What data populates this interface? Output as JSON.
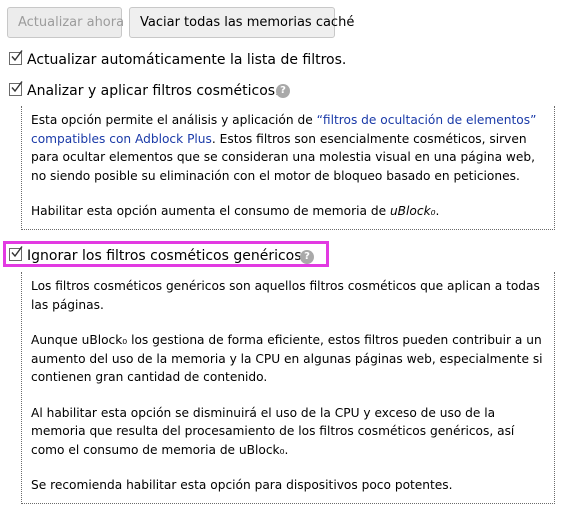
{
  "toolbar": {
    "update_now_label": "Actualizar ahora",
    "purge_caches_label": "Vaciar todas las memorias caché"
  },
  "options": {
    "auto_update": {
      "label": "Actualizar automáticamente la lista de filtros.",
      "checked": true
    },
    "cosmetic": {
      "label": "Analizar y aplicar filtros cosméticos.",
      "checked": true,
      "help": "?",
      "desc_p1_a": "Esta opción permite el análisis y aplicación de ",
      "desc_p1_link": "“filtros de ocultación de elementos” compatibles con Adblock Plus",
      "desc_p1_b": ". Estos filtros son esencialmente cosméticos, sirven para ocultar elementos que se consideran una molestia visual en una página web, no siendo posible su eliminación con el motor de bloqueo basado en peticiones.",
      "desc_p2_a": "Habilitar esta opción aumenta el consumo de memoria de ",
      "desc_p2_brand": "uBlock₀",
      "desc_p2_b": "."
    },
    "generic_cosmetic": {
      "label": "Ignorar los filtros cosméticos genéricos",
      "checked": true,
      "help": "?",
      "desc_p1": "Los filtros cosméticos genéricos son aquellos filtros cosméticos que aplican a todas las páginas.",
      "desc_p2": "Aunque uBlock₀ los gestiona de forma eficiente, estos filtros pueden contribuir a un aumento del uso de la memoria y la CPU en algunas páginas web, especialmente si contienen gran cantidad de contenido.",
      "desc_p3": "Al habilitar esta opción se disminuirá el uso de la CPU y exceso de uso de la memoria que resulta del procesamiento de los filtros cosméticos genéricos, así como el consumo de memoria de uBlock₀.",
      "desc_p4": "Se recomienda habilitar esta opción para dispositivos poco potentes."
    }
  },
  "colors": {
    "highlight": "#e23ae2",
    "link": "#1a3aa8",
    "help_icon": "#a9a9a9"
  }
}
